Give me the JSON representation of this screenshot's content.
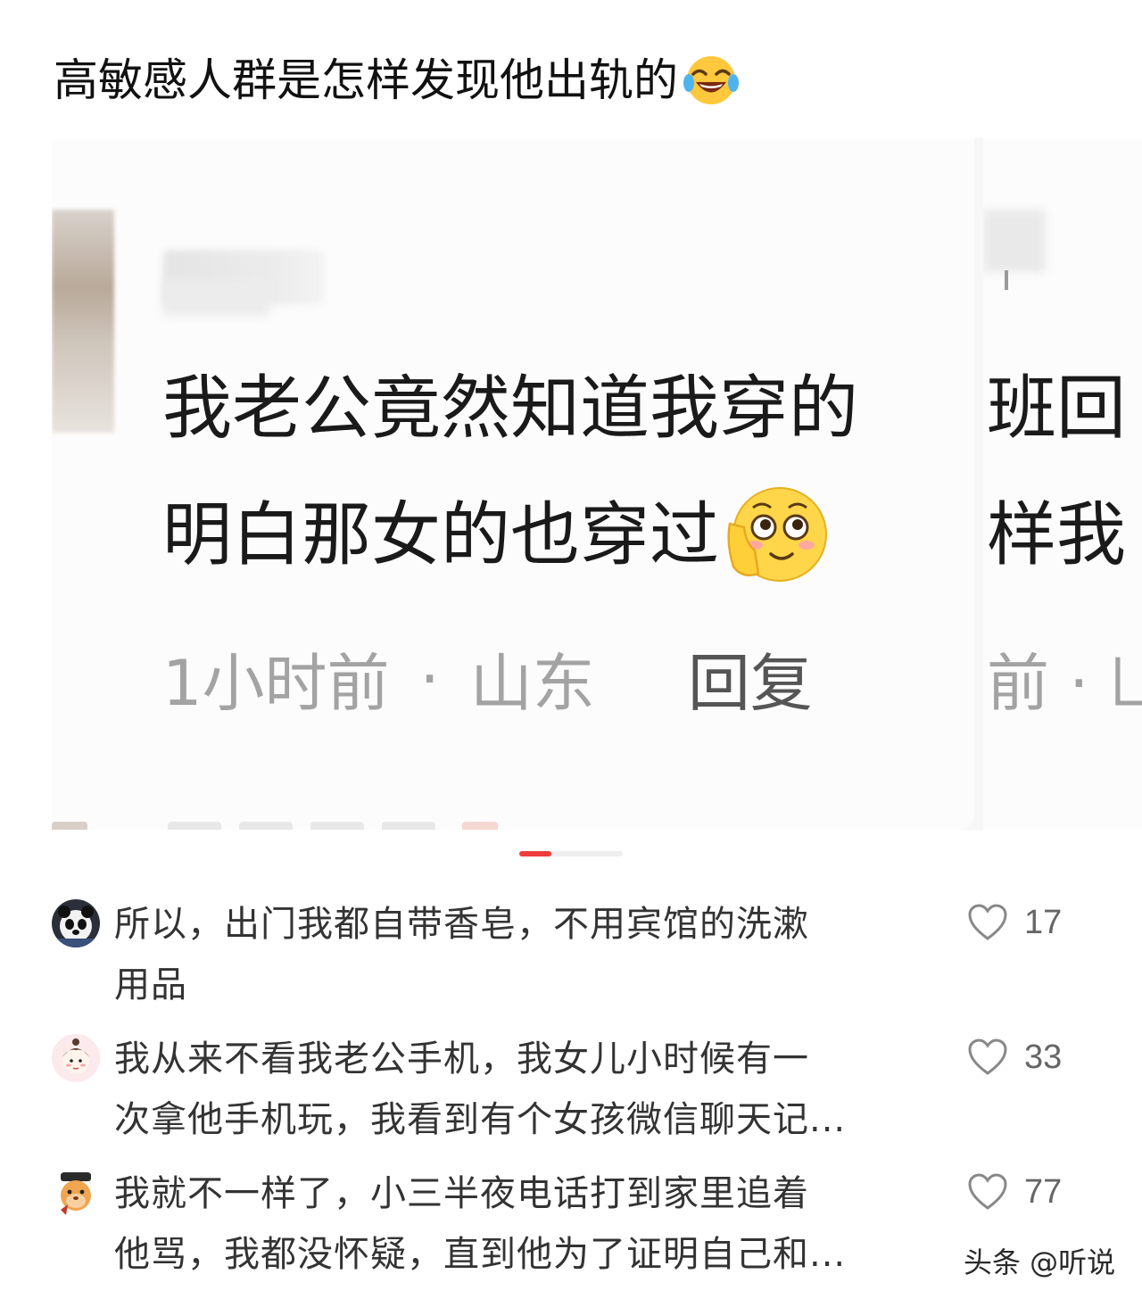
{
  "post": {
    "title": "高敏感人群是怎样发现他出轨的",
    "title_emoji": "face-with-tears-of-joy-icon"
  },
  "image_slide": {
    "comment_line_1": "我老公竟然知道我穿的",
    "comment_line_2": "明白那女的也穿过",
    "comment_emoji": "shy-face-icon",
    "time": "1小时前",
    "separator": "·",
    "location": "山东",
    "reply_label": "回复",
    "next_slide_line_1": "班回",
    "next_slide_line_2": "样我",
    "next_slide_meta": "前 · 凵"
  },
  "carousel": {
    "total": 3,
    "active": 1,
    "active_color": "#f03c3c"
  },
  "comments": [
    {
      "avatar": "panda-avatar",
      "line_1": "所以，出门我都自带香皂，不用宾馆的洗漱",
      "line_2": "用品",
      "likes": "17"
    },
    {
      "avatar": "cartoon-girl-avatar",
      "line_1": "我从来不看我老公手机，我女儿小时候有一",
      "line_2": "次拿他手机玩，我看到有个女孩微信聊天记...",
      "likes": "33"
    },
    {
      "avatar": "cartoon-character-avatar",
      "line_1": "我就不一样了，小三半夜电话打到家里追着",
      "line_2": "他骂，我都没怀疑，直到他为了证明自己和...",
      "likes": "77"
    }
  ],
  "watermark": "头条 @听说"
}
